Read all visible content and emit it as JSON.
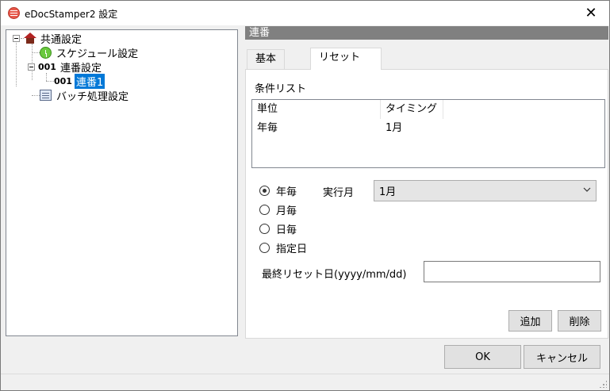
{
  "window": {
    "title": "eDocStamper2 設定",
    "close_glyph": "✕"
  },
  "tree": {
    "items": [
      {
        "label": "共通設定",
        "icon": "house-icon"
      },
      {
        "label": "スケジュール設定",
        "icon": "clock-icon"
      },
      {
        "label": "連番設定",
        "icon_text": "001"
      },
      {
        "label": "連番1",
        "icon_text": "001",
        "selected": true
      },
      {
        "label": "バッチ処理設定",
        "icon": "batch-icon"
      }
    ]
  },
  "section": {
    "header": "連番"
  },
  "tabs": [
    {
      "label": "基本"
    },
    {
      "label": "リセット",
      "active": true
    }
  ],
  "reset": {
    "list_title": "条件リスト",
    "columns": [
      "単位",
      "タイミング"
    ],
    "rows": [
      [
        "年毎",
        "1月"
      ]
    ],
    "radios": [
      {
        "label": "年毎",
        "checked": true
      },
      {
        "label": "月毎",
        "checked": false
      },
      {
        "label": "日毎",
        "checked": false
      },
      {
        "label": "指定日",
        "checked": false
      }
    ],
    "exec_month_label": "実行月",
    "exec_month_value": "1月",
    "last_reset_label": "最終リセット日(yyyy/mm/dd)",
    "last_reset_value": "",
    "add_button": "追加",
    "delete_button": "削除"
  },
  "footer": {
    "ok_button": "OK",
    "cancel_button": "キャンセル"
  }
}
